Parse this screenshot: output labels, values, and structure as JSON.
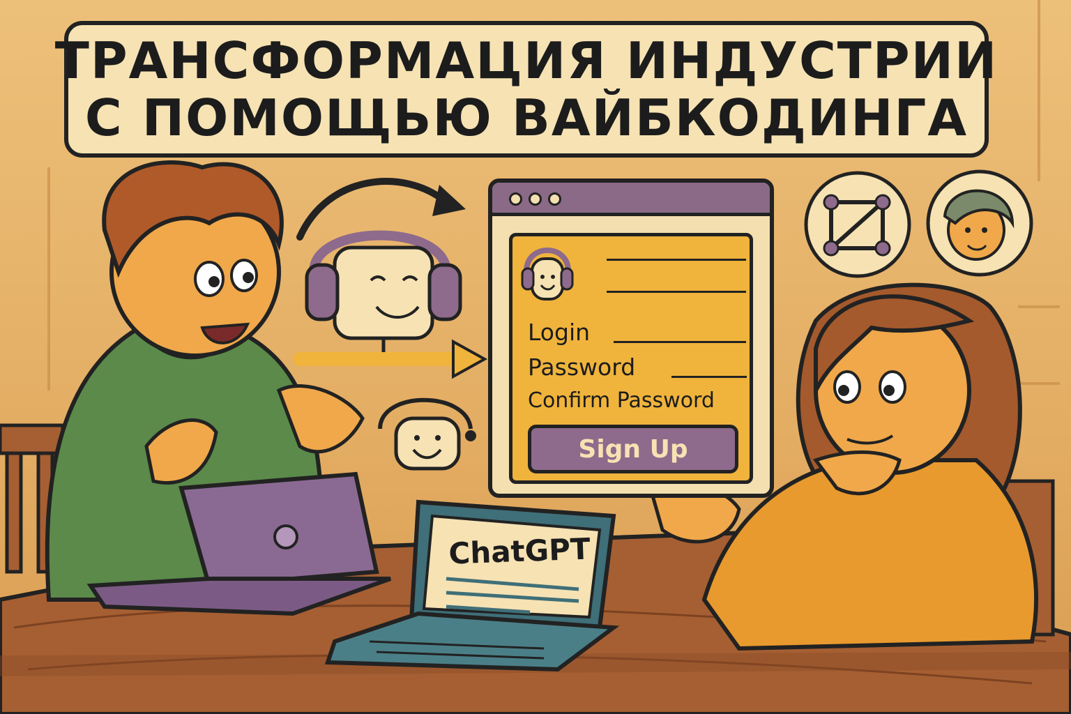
{
  "title": {
    "line1": "ТРАНСФОРМАЦИЯ ИНДУСТРИИ",
    "line2": "С ПОМОЩЬЮ ВАЙБКОДИНГА"
  },
  "form": {
    "login_label": "Login",
    "password_label": "Password",
    "confirm_password_label": "Confirm Password",
    "signup_label": "Sign Up"
  },
  "laptop_screen_text": "ChatGPT",
  "colors": {
    "wall": "#e6b266",
    "title_box": "#f6e2b3",
    "form_panel": "#f0b43c",
    "signup_button": "#8e6a8c",
    "window_bar": "#8a6a86",
    "man_sweater": "#5b8a4a",
    "woman_sweater": "#e89a2e",
    "table": "#a0582e"
  },
  "icons": [
    "headset-bot-icon",
    "arrow-icon",
    "network-square-icon",
    "face-avatar-icon",
    "user-avatar-icon"
  ]
}
